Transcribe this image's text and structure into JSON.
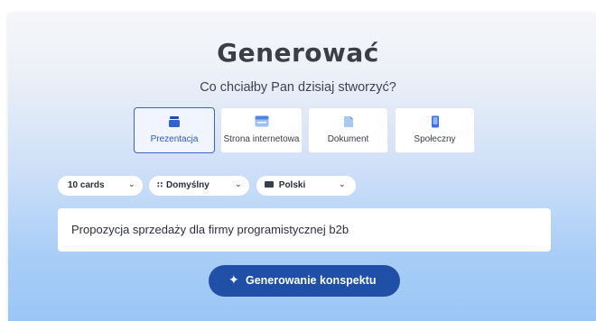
{
  "header": {
    "title": "Generować",
    "subtitle": "Co chciałby Pan dzisiaj stworzyć?"
  },
  "content_types": [
    {
      "label": "Prezentacja",
      "icon": "presentation-icon",
      "selected": true
    },
    {
      "label": "Strona internetowa",
      "icon": "webpage-icon",
      "selected": false
    },
    {
      "label": "Dokument",
      "icon": "document-icon",
      "selected": false
    },
    {
      "label": "Społeczny",
      "icon": "social-icon",
      "selected": false
    }
  ],
  "options": {
    "cards": "10 cards",
    "theme": "Domyślny",
    "language": "Polski"
  },
  "prompt": {
    "value": "Propozycja sprzedaży dla firmy programistycznej b2b"
  },
  "generate_button": {
    "label": "Generowanie konspektu"
  },
  "colors": {
    "accent": "#1f4fa6",
    "selected_border": "#3a63c9",
    "icon_blue": "#3b6fd8"
  }
}
